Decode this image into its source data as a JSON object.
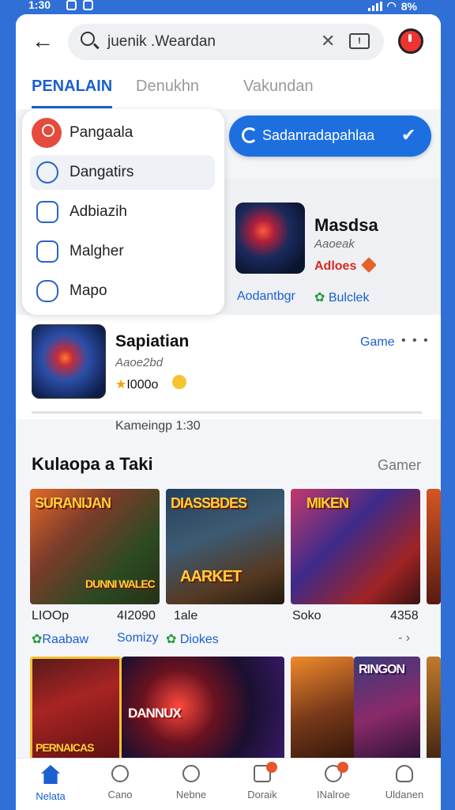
{
  "status_bar": {
    "time": "1:30",
    "battery": "8%"
  },
  "search": {
    "query": "juenik .Weardan",
    "clear_glyph": "✕",
    "kbd_glyph": "!"
  },
  "tabs": [
    {
      "label": "PENALAIN",
      "active": true
    },
    {
      "label": "Denukhn",
      "active": false
    },
    {
      "label": "Vakundan",
      "active": false
    }
  ],
  "dropdown": {
    "items": [
      {
        "label": "Pangaala",
        "icon": "user-icon",
        "selected": false
      },
      {
        "label": "Dangatirs",
        "icon": "puzzle-icon",
        "selected": true
      },
      {
        "label": "Adbiazih",
        "icon": "list-icon",
        "selected": false
      },
      {
        "label": "Malgher",
        "icon": "document-icon",
        "selected": false
      },
      {
        "label": "Mapo",
        "icon": "box-icon",
        "selected": false
      }
    ]
  },
  "primary_action": {
    "label": "Sadanradapahlaa",
    "check": "✔"
  },
  "featured": {
    "title": "Masdsa",
    "subtitle": "Aaoeak",
    "price": "Adloes",
    "link_left": "Aodantbgr",
    "link_right": "Bulclek",
    "link_right_icon": "gear-icon"
  },
  "listing": {
    "title": "Sapiatian",
    "subtitle": "Aaoe2bd",
    "rating": "I000o",
    "star": "★",
    "link": "Game",
    "dots": "• • •"
  },
  "caption": "Kameingp 1:30",
  "section": {
    "title": "Kulaopa a Taki",
    "link": "Gamer"
  },
  "games_row1": [
    {
      "title": "SURANIJAN",
      "subtitle": "DUNNI WALEC"
    },
    {
      "title": "DIASSBDES",
      "subtitle": "AARKET"
    },
    {
      "title": "MIKEN",
      "subtitle": ""
    }
  ],
  "games_row1_meta": [
    {
      "left": "LIOOp",
      "right": "4I2090"
    },
    {
      "left": "1ale",
      "right": ""
    },
    {
      "left": "Soko",
      "right": "4358"
    }
  ],
  "games_row1_links": [
    {
      "label": "Raabaw",
      "icon": "gear-icon"
    },
    {
      "label": "Somizy",
      "icon": ""
    },
    {
      "label": "Diokes",
      "icon": "gear-icon"
    }
  ],
  "games_row1_more": "- ›",
  "games_row2": [
    {
      "title": "PERNAICAS"
    },
    {
      "title": "DANNUX"
    },
    {
      "title": ""
    },
    {
      "title": "RINGON"
    }
  ],
  "bottom_nav": [
    {
      "label": "Nelata",
      "icon": "home-icon",
      "active": true
    },
    {
      "label": "Cano",
      "icon": "search-icon",
      "active": false
    },
    {
      "label": "Nebne",
      "icon": "search-icon",
      "active": false
    },
    {
      "label": "Doraik",
      "icon": "grid-icon",
      "active": false,
      "badge": true
    },
    {
      "label": "INalroe",
      "icon": "search-icon",
      "active": false,
      "badge": true
    },
    {
      "label": "Uldanen",
      "icon": "user-icon",
      "active": false
    }
  ],
  "colors": {
    "accent": "#1b5fd0",
    "price_red": "#d8281f",
    "tag_orange": "#e6622c"
  }
}
